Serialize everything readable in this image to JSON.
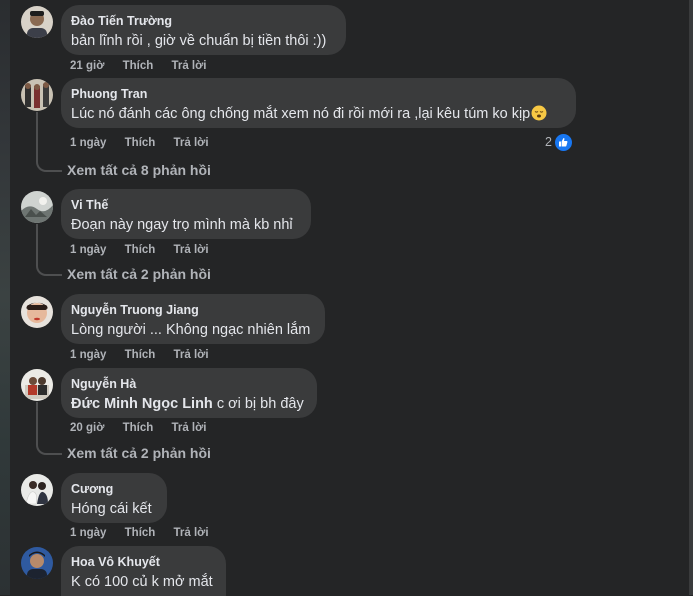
{
  "comments": [
    {
      "name": "Đào Tiến Trường",
      "text": "bản lĩnh rồi , giờ về chuẩn bị tiền thôi :))",
      "time": "21 giờ",
      "like": "Thích",
      "reply": "Trả lời"
    },
    {
      "name": "Phuong Tran",
      "text": "Lúc nó đánh các ông chống mắt xem nó đi rồi mới ra ,lại kêu túm ko kịp",
      "time": "1 ngày",
      "like": "Thích",
      "reply": "Trả lời",
      "reactions": "2",
      "replies_link": "Xem tất cả 8 phản hồi"
    },
    {
      "name": "Vi Thế",
      "text": "Đoạn này ngay trọ mình mà kb nhỉ",
      "time": "1 ngày",
      "like": "Thích",
      "reply": "Trả lời",
      "replies_link": "Xem tất cả 2 phản hồi"
    },
    {
      "name": "Nguyễn Truong Jiang",
      "text": "Lòng người ... Không ngạc nhiên lắm",
      "time": "1 ngày",
      "like": "Thích",
      "reply": "Trả lời"
    },
    {
      "name": "Nguyễn Hà",
      "mention": "Đức Minh Ngọc Linh",
      "text": "c ơi bị bh đây",
      "time": "20 giờ",
      "like": "Thích",
      "reply": "Trả lời",
      "replies_link": "Xem tất cả 2 phản hồi"
    },
    {
      "name": "Cương",
      "text": "Hóng cái kết",
      "time": "1 ngày",
      "like": "Thích",
      "reply": "Trả lời"
    },
    {
      "name": "Hoa Vô Khuyết",
      "text": "K có 100 củ k mở mắt"
    }
  ],
  "colors": {
    "background": "#242526",
    "bubble": "#3a3b3c",
    "text": "#e4e6eb",
    "meta": "#b0b3b8",
    "like": "#1877f2"
  },
  "icons": {
    "reaction": "like-icon",
    "emoji": "sleepy-face-emoji"
  }
}
